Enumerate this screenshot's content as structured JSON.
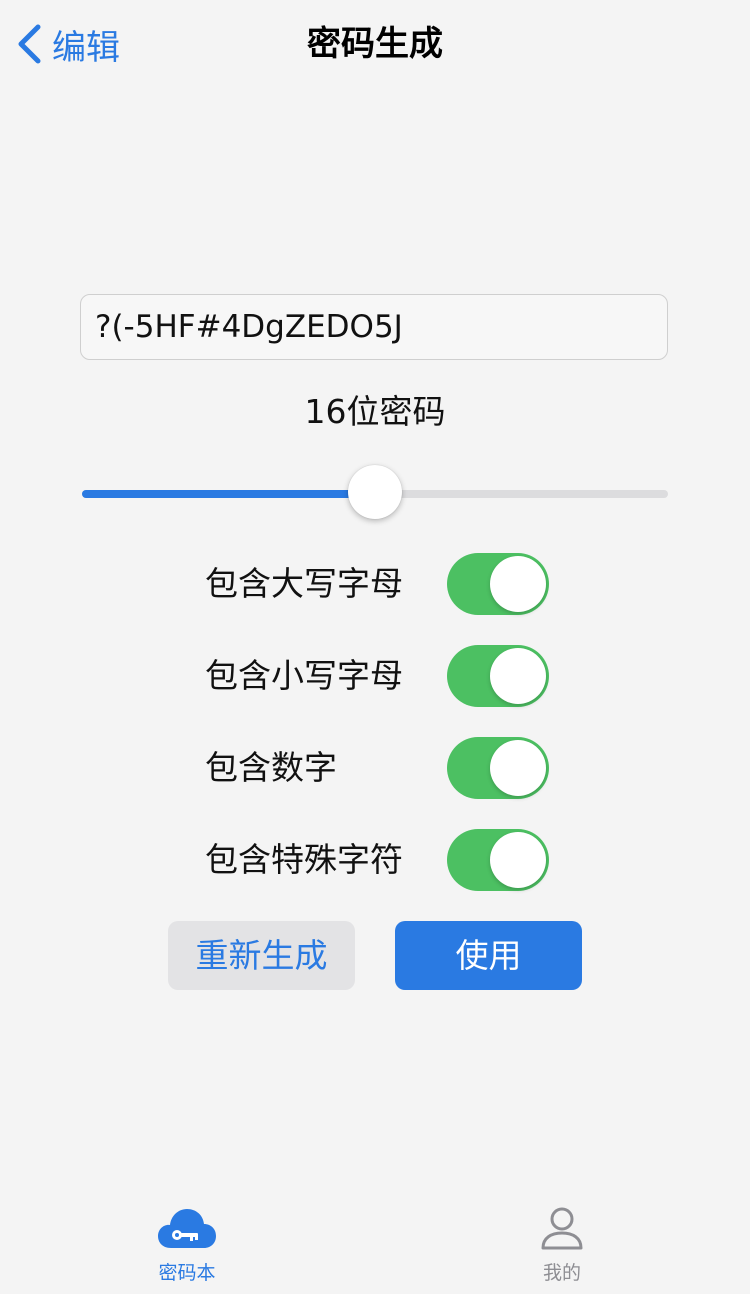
{
  "nav": {
    "back_label": "编辑",
    "title": "密码生成"
  },
  "password": {
    "value": "?(-5HF#4DgZEDO5J"
  },
  "length": {
    "label": "16位密码",
    "slider_fraction": 0.5
  },
  "options": [
    {
      "label": "包含大写字母",
      "enabled": true
    },
    {
      "label": "包含小写字母",
      "enabled": true
    },
    {
      "label": "包含数字",
      "enabled": true
    },
    {
      "label": "包含特殊字符",
      "enabled": true
    }
  ],
  "buttons": {
    "regenerate": "重新生成",
    "use": "使用"
  },
  "tabbar": {
    "vault_label": "密码本",
    "me_label": "我的"
  },
  "colors": {
    "accent": "#2a7ae2",
    "toggle_on": "#4cc062",
    "background": "#f4f4f4",
    "tab_inactive": "#8e8e93"
  },
  "icons": {
    "back": "chevron-left-icon",
    "vault_tab": "cloud-key-icon",
    "me_tab": "person-icon"
  }
}
